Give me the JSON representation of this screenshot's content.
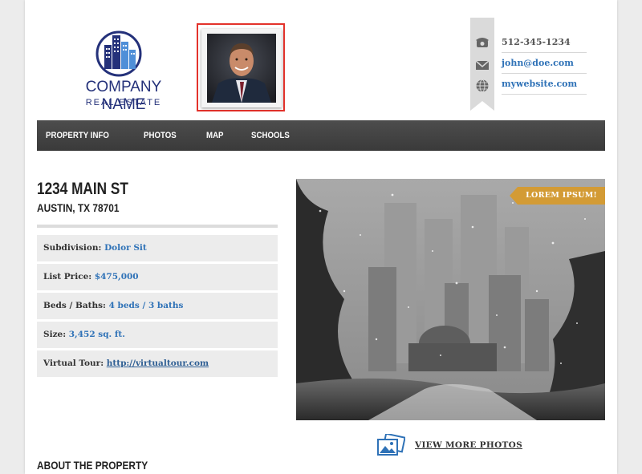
{
  "brand": {
    "company_name": "COMPANY NAME",
    "company_sub": "REAL ESTATE",
    "logo_color": "#24317a",
    "logo_accent": "#4f8fd8"
  },
  "agent_photo": {
    "icon": "agent-portrait",
    "highlight_color": "#e3322b"
  },
  "contact": {
    "phone": "512-345-1234",
    "email": "john@doe.com",
    "website": "mywebsite.com",
    "phone_icon": "phone-icon",
    "email_icon": "envelope-icon",
    "website_icon": "globe-icon"
  },
  "nav": {
    "items": [
      "PROPERTY INFO",
      "PHOTOS",
      "MAP",
      "SCHOOLS"
    ]
  },
  "property": {
    "address_line1": "1234 MAIN ST",
    "address_line2": "AUSTIN, TX 78701",
    "details": [
      {
        "label": "Subdivision:",
        "value": "Dolor Sit"
      },
      {
        "label": "List Price:",
        "value": "$475,000"
      },
      {
        "label": "Beds / Baths:",
        "value": "4 beds / 3 baths"
      },
      {
        "label": "Size:",
        "value": "3,452 sq. ft."
      },
      {
        "label": "Virtual Tour:",
        "value": "http://virtualtour.com"
      }
    ]
  },
  "gallery": {
    "badge": "LOREM IPSUM!",
    "badge_color": "#d39b35",
    "view_more": "VIEW MORE PHOTOS"
  },
  "sections": {
    "about_heading": "ABOUT THE PROPERTY"
  },
  "colors": {
    "link": "#2f72b7",
    "nav_bg": "#444444"
  }
}
